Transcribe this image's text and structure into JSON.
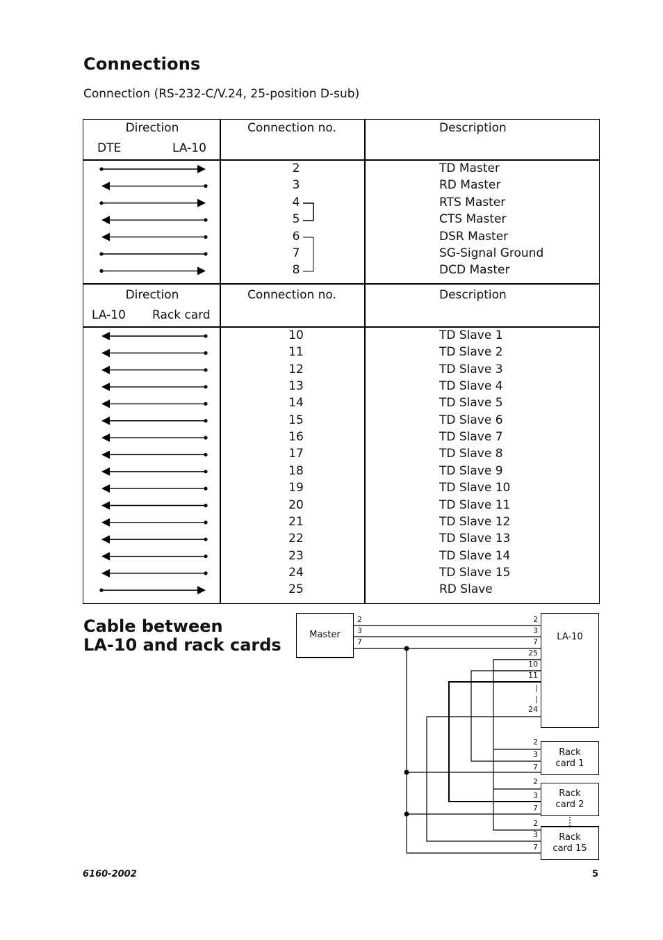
{
  "page": {
    "title": "Connections",
    "subtitle": "Connection (RS-232-C/V.24, 25-position D-sub)",
    "section2_title_line1": "Cable between",
    "section2_title_line2": "LA-10 and rack cards",
    "footer_doc_number": "6160-2002",
    "footer_page_number": "5"
  },
  "table": {
    "section1": {
      "header": {
        "direction": "Direction",
        "left_end": "DTE",
        "right_end": "LA-10",
        "connection_no": "Connection no.",
        "description": "Description"
      },
      "rows": [
        {
          "dir": "right",
          "no": "2",
          "desc": "TD Master"
        },
        {
          "dir": "left",
          "no": "3",
          "desc": "RD Master"
        },
        {
          "dir": "right",
          "no": "4",
          "desc": "RTS Master"
        },
        {
          "dir": "left",
          "no": "5",
          "desc": "CTS Master"
        },
        {
          "dir": "left",
          "no": "6",
          "desc": "DSR Master"
        },
        {
          "dir": "none",
          "no": "7",
          "desc": "SG-Signal Ground"
        },
        {
          "dir": "right",
          "no": "8",
          "desc": "DCD Master"
        }
      ],
      "brackets": [
        [
          "4",
          "5"
        ],
        [
          "6",
          "8"
        ]
      ]
    },
    "section2": {
      "header": {
        "direction": "Direction",
        "left_end": "LA-10",
        "right_end": "Rack card",
        "connection_no": "Connection no.",
        "description": "Description"
      },
      "rows": [
        {
          "dir": "left",
          "no": "10",
          "desc": "TD Slave 1"
        },
        {
          "dir": "left",
          "no": "11",
          "desc": "TD Slave 2"
        },
        {
          "dir": "left",
          "no": "12",
          "desc": "TD Slave 3"
        },
        {
          "dir": "left",
          "no": "13",
          "desc": "TD Slave 4"
        },
        {
          "dir": "left",
          "no": "14",
          "desc": "TD Slave 5"
        },
        {
          "dir": "left",
          "no": "15",
          "desc": "TD Slave 6"
        },
        {
          "dir": "left",
          "no": "16",
          "desc": "TD Slave 7"
        },
        {
          "dir": "left",
          "no": "17",
          "desc": "TD Slave 8"
        },
        {
          "dir": "left",
          "no": "18",
          "desc": "TD Slave 9"
        },
        {
          "dir": "left",
          "no": "19",
          "desc": "TD Slave 10"
        },
        {
          "dir": "left",
          "no": "20",
          "desc": "TD Slave 11"
        },
        {
          "dir": "left",
          "no": "21",
          "desc": "TD Slave 12"
        },
        {
          "dir": "left",
          "no": "22",
          "desc": "TD Slave 13"
        },
        {
          "dir": "left",
          "no": "23",
          "desc": "TD Slave 14"
        },
        {
          "dir": "left",
          "no": "24",
          "desc": "TD Slave 15"
        },
        {
          "dir": "right",
          "no": "25",
          "desc": "RD Slave"
        }
      ]
    }
  },
  "diagram": {
    "master": {
      "label": "Master",
      "pins": [
        "2",
        "3",
        "7"
      ]
    },
    "la10": {
      "label": "LA-10",
      "pins": [
        "2",
        "3",
        "7",
        "25",
        "10",
        "11",
        "|",
        "|",
        "24"
      ]
    },
    "rack_cards": [
      {
        "label_line1": "Rack",
        "label_line2": "card 1",
        "pins": [
          "2",
          "3",
          "7"
        ]
      },
      {
        "label_line1": "Rack",
        "label_line2": "card 2",
        "pins": [
          "2",
          "3",
          "7"
        ]
      },
      {
        "label_line1": "Rack",
        "label_line2": "card 15",
        "pins": [
          "2",
          "3",
          "7"
        ]
      }
    ],
    "ellipsis": "⋮"
  }
}
